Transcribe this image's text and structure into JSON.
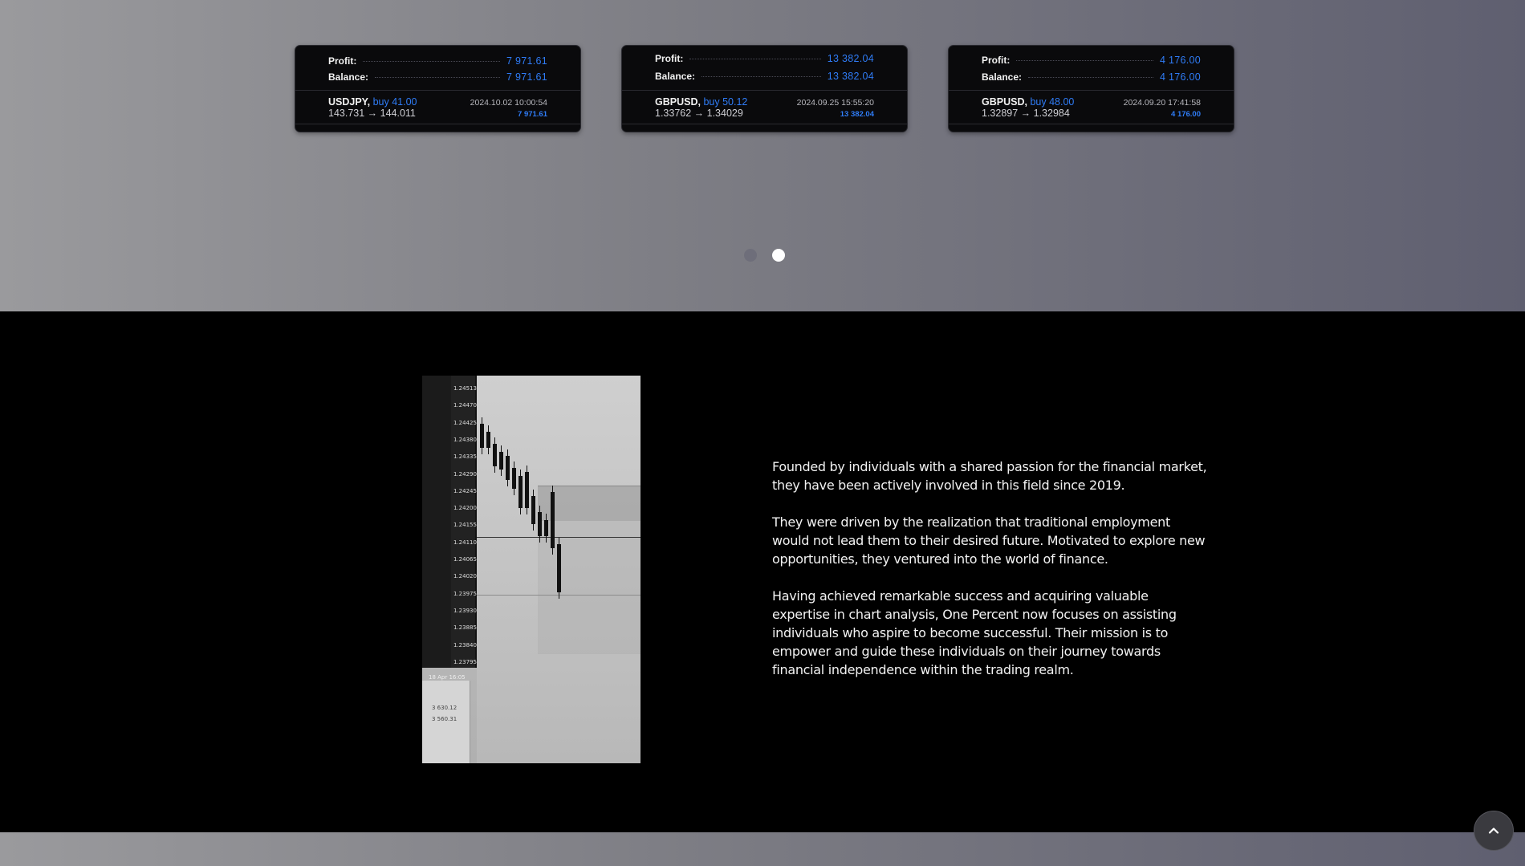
{
  "cards": [
    {
      "profit_label": "Profit:",
      "profit_value": "7 971.61",
      "balance_label": "Balance:",
      "balance_value": "7 971.61",
      "symbol": "USDJPY,",
      "trade": "buy 41.00",
      "rate": "143.731 → 144.011",
      "date": "2024.10.02 10:00:54",
      "pl": "7 971.61"
    },
    {
      "profit_label": "Profit:",
      "profit_value": "13 382.04",
      "balance_label": "Balance:",
      "balance_value": "13 382.04",
      "symbol": "GBPUSD,",
      "trade": "buy 50.12",
      "rate": "1.33762 → 1.34029",
      "date": "2024.09.25 15:55:20",
      "pl": "13 382.04"
    },
    {
      "profit_label": "Profit:",
      "profit_value": "4 176.00",
      "balance_label": "Balance:",
      "balance_value": "4 176.00",
      "symbol": "GBPUSD,",
      "trade": "buy 48.00",
      "rate": "1.32897 → 1.32984",
      "date": "2024.09.20 17:41:58",
      "pl": "4 176.00"
    }
  ],
  "carousel": {
    "pages": 2,
    "active_page": 2
  },
  "photo": {
    "price_ticks": [
      "1.24513",
      "1.24470",
      "1.24425",
      "1.24380",
      "1.24335",
      "1.24290",
      "1.24245",
      "1.24200",
      "1.24155",
      "1.24110",
      "1.24065",
      "1.24020",
      "1.23975",
      "1.23930",
      "1.23885",
      "1.23840",
      "1.23795"
    ],
    "date_label": "18 Apr 16:05",
    "values": [
      "3 630.12",
      "3 560.31"
    ]
  },
  "about": {
    "p1": "Founded by individuals with a shared passion for the financial market, they have been actively involved in this field since 2019.",
    "p2": "They were driven by the realization that traditional employment would not lead them to their desired future. Motivated to explore new opportunities, they ventured into the world of finance.",
    "p3": "Having achieved remarkable success and acquiring valuable expertise in chart analysis, One Percent now focuses on assisting individuals who aspire to become successful. Their mission is to empower and guide these individuals on their journey towards financial independence within the trading realm."
  },
  "colors": {
    "accent": "#2f7cf6",
    "card_bg": "#0a0a0c",
    "dot_active": "#ffffff",
    "dot_inactive": "#6e6e7a"
  },
  "icons": {
    "scroll_top": "chevron-up-icon"
  }
}
